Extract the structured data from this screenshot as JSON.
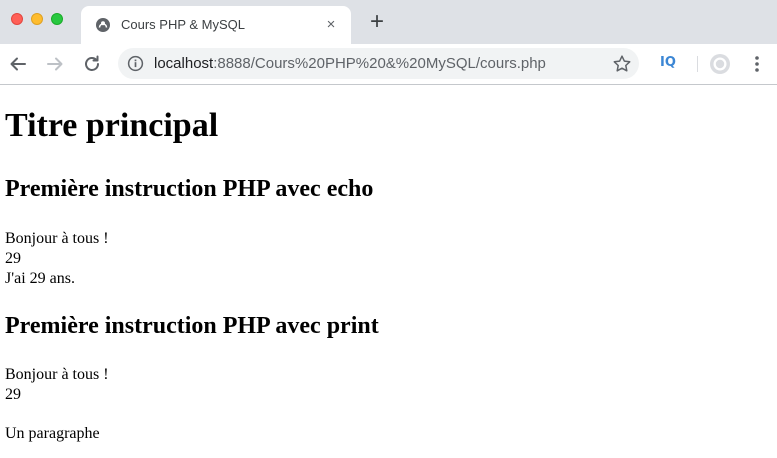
{
  "browser": {
    "tab": {
      "title": "Cours PHP & MySQL",
      "favicon": "globe-icon",
      "close_label": "×"
    },
    "new_tab_label": "+",
    "address_bar": {
      "host": "localhost",
      "path": ":8888/Cours%20PHP%20&%20MySQL/cours.php"
    },
    "extension_label": "IQ",
    "colors": {
      "tabstrip": "#dee1e6",
      "omnibox": "#f1f3f4",
      "extension": "#3b86d4"
    }
  },
  "page": {
    "title": "Titre principal",
    "section_echo": {
      "heading": "Première instruction PHP avec echo",
      "lines": [
        "Bonjour à tous !",
        "29",
        "J'ai 29 ans."
      ]
    },
    "section_print": {
      "heading": "Première instruction PHP avec print",
      "lines": [
        "Bonjour à tous !",
        "29"
      ]
    },
    "paragraph": "Un paragraphe"
  }
}
